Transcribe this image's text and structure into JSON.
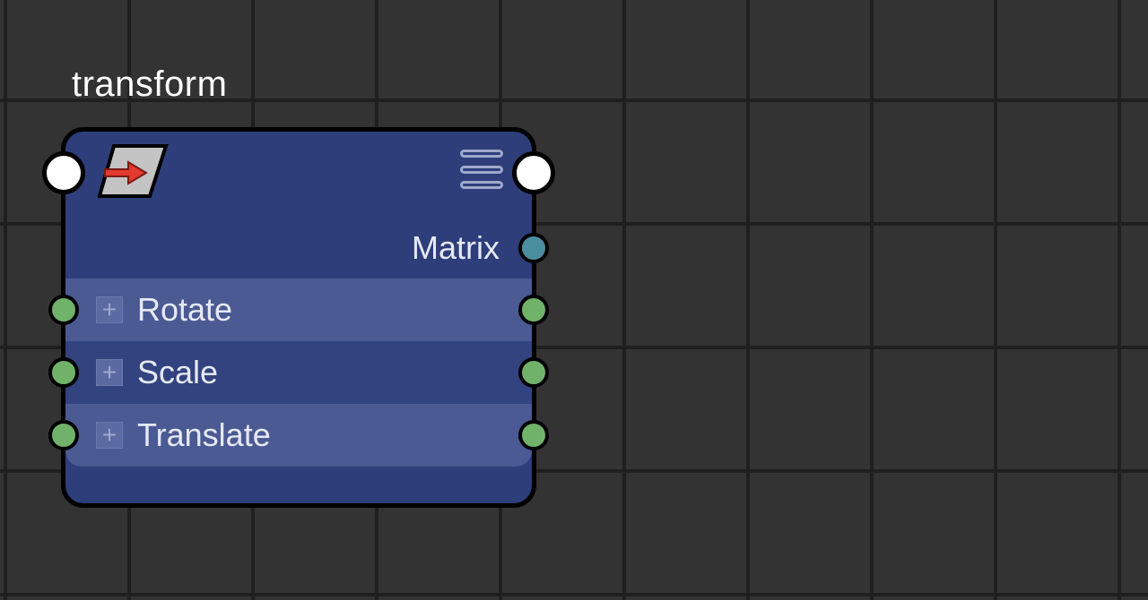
{
  "node": {
    "label": "transform",
    "outputs": [
      {
        "label": "Matrix",
        "socket_color": "teal"
      }
    ],
    "params": [
      {
        "label": "Rotate",
        "expandable": true,
        "socket_color": "green"
      },
      {
        "label": "Scale",
        "expandable": true,
        "socket_color": "green"
      },
      {
        "label": "Translate",
        "expandable": true,
        "socket_color": "green"
      }
    ],
    "exec_in": {
      "color": "white"
    },
    "exec_out": {
      "color": "white"
    },
    "icons": {
      "node_icon": "transform-geometry-icon",
      "menu_icon": "menu-icon"
    }
  },
  "colors": {
    "canvas_bg": "#333333",
    "grid_line": "#1f1f1f",
    "node_bg": "#2e3e7a",
    "node_border": "#000000",
    "socket_white": "#ffffff",
    "socket_teal": "#4a8ea0",
    "socket_green": "#71b26b"
  }
}
